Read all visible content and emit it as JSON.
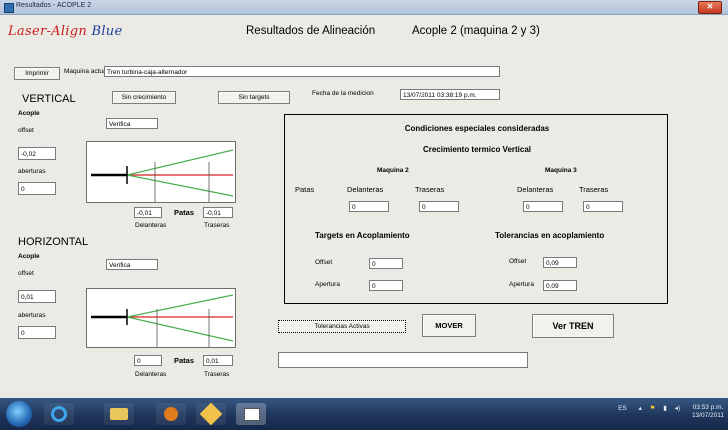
{
  "window": {
    "title": "Resultados - ACOPLE 2",
    "close_glyph": "✕"
  },
  "logo": {
    "part1": "Laser-Align",
    "part2": "Blue"
  },
  "header": {
    "title": "Resultados de Alineación",
    "subtitle": "Acople 2  (maquina 2 y 3)"
  },
  "toolbar": {
    "print_label": "Imprimir",
    "machine_label": "Maquina actual",
    "machine_value": "Tren turbina-caja-alternador"
  },
  "vertical": {
    "title": "VERTICAL",
    "no_growth_label": "Sin crecimiento",
    "no_targets_label": "Sin targets",
    "date_label": "Fecha de la medicion",
    "date_value": "13/07/2011 03:38:19 p.m.",
    "acople_label": "Acople",
    "verifica_value": "Verifica",
    "offset_label": "offset",
    "offset_value": "-0,02",
    "aberturas_label": "aberturas",
    "aberturas_value": "0",
    "front_value": "-0,01",
    "patas_label": "Patas",
    "rear_value": "-0,01",
    "front_label": "Delanteras",
    "rear_label": "Traseras"
  },
  "horizontal": {
    "title": "HORIZONTAL",
    "acople_label": "Acople",
    "verifica_value": "Verifica",
    "offset_label": "offset",
    "offset_value": "0,01",
    "aberturas_label": "aberturas",
    "aberturas_value": "0",
    "front_value": "0",
    "patas_label": "Patas",
    "rear_value": "0,01",
    "front_label": "Delanteras",
    "rear_label": "Traseras"
  },
  "panel": {
    "title": "Condiciones especiales consideradas",
    "growth_title": "Crecimiento termico Vertical",
    "machine2": "Maquina 2",
    "machine3": "Maquina 3",
    "patas": "Patas",
    "delanteras": "Delanteras",
    "traseras": "Traseras",
    "m2_front": "0",
    "m2_rear": "0",
    "m3_front": "0",
    "m3_rear": "0",
    "targets_title": "Targets en Acoplamiento",
    "tolerances_title": "Tolerancias en acoplamiento",
    "offset_label": "Offset",
    "apertura_label": "Apertura",
    "targets_offset": "0",
    "targets_apertura": "0",
    "tol_offset": "0,09",
    "tol_apertura": "0,09"
  },
  "actions": {
    "tolerances_active": "Tolerancias Activas",
    "mover": "MOVER",
    "ver_tren": "Ver TREN",
    "message_value": ""
  },
  "taskbar": {
    "lang": "ES",
    "time": "03:53 p.m.",
    "date": "13/07/2011"
  },
  "colors": {
    "green_line": "#4caf50",
    "red_line": "#d62020",
    "logo_red": "#c81e1e",
    "logo_blue": "#1b3d9a"
  }
}
